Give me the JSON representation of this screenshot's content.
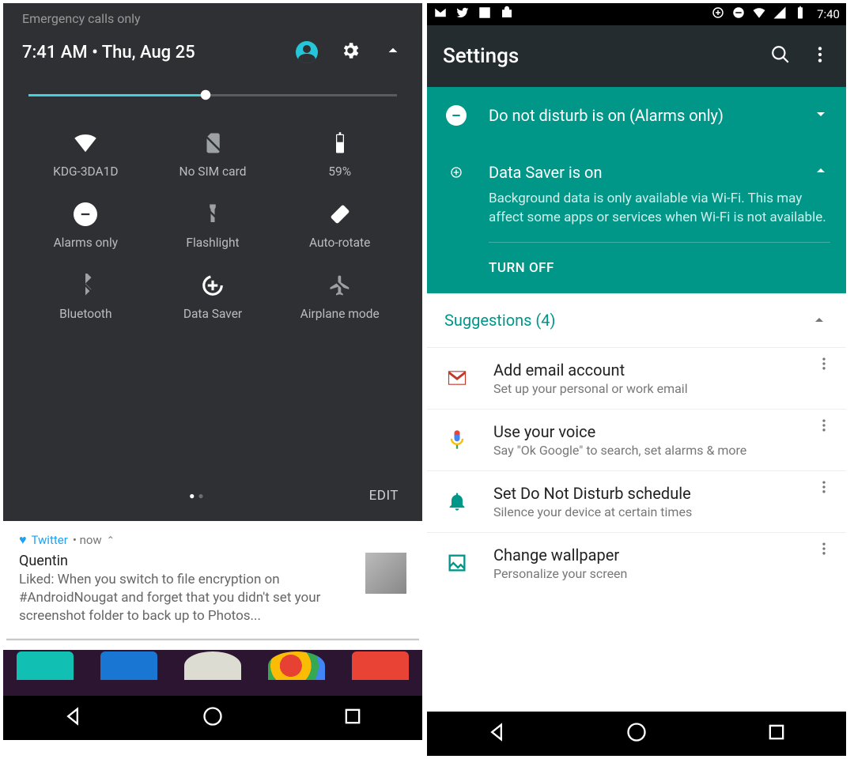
{
  "left": {
    "emergency": "Emergency calls only",
    "clock": "7:41 AM  •  Thu, Aug 25",
    "tiles": {
      "wifi": "KDG-3DA1D",
      "sim": "No SIM card",
      "battery": "59%",
      "dnd": "Alarms only",
      "flash": "Flashlight",
      "rotate": "Auto-rotate",
      "bt": "Bluetooth",
      "ds": "Data Saver",
      "air": "Airplane mode"
    },
    "edit": "EDIT",
    "notif": {
      "app": "Twitter",
      "time": " • now ",
      "title": "Quentin",
      "msg": "Liked: When you switch to file encryption on #AndroidNougat and forget that you didn't set your screenshot folder to back up to Photos..."
    }
  },
  "right": {
    "clock": "7:40",
    "title": "Settings",
    "dnd": "Do not disturb is on (Alarms only)",
    "ds_title": "Data Saver is on",
    "ds_desc": "Background data is only available via Wi-Fi. This may affect some apps or services when Wi-Fi is not available.",
    "ds_action": "TURN OFF",
    "sugg": "Suggestions (4)",
    "items": [
      {
        "title": "Add email account",
        "sub": "Set up your personal or work email"
      },
      {
        "title": "Use your voice",
        "sub": "Say \"Ok Google\" to search, set alarms & more"
      },
      {
        "title": "Set Do Not Disturb schedule",
        "sub": "Silence your device at certain times"
      },
      {
        "title": "Change wallpaper",
        "sub": "Personalize your screen"
      }
    ]
  }
}
